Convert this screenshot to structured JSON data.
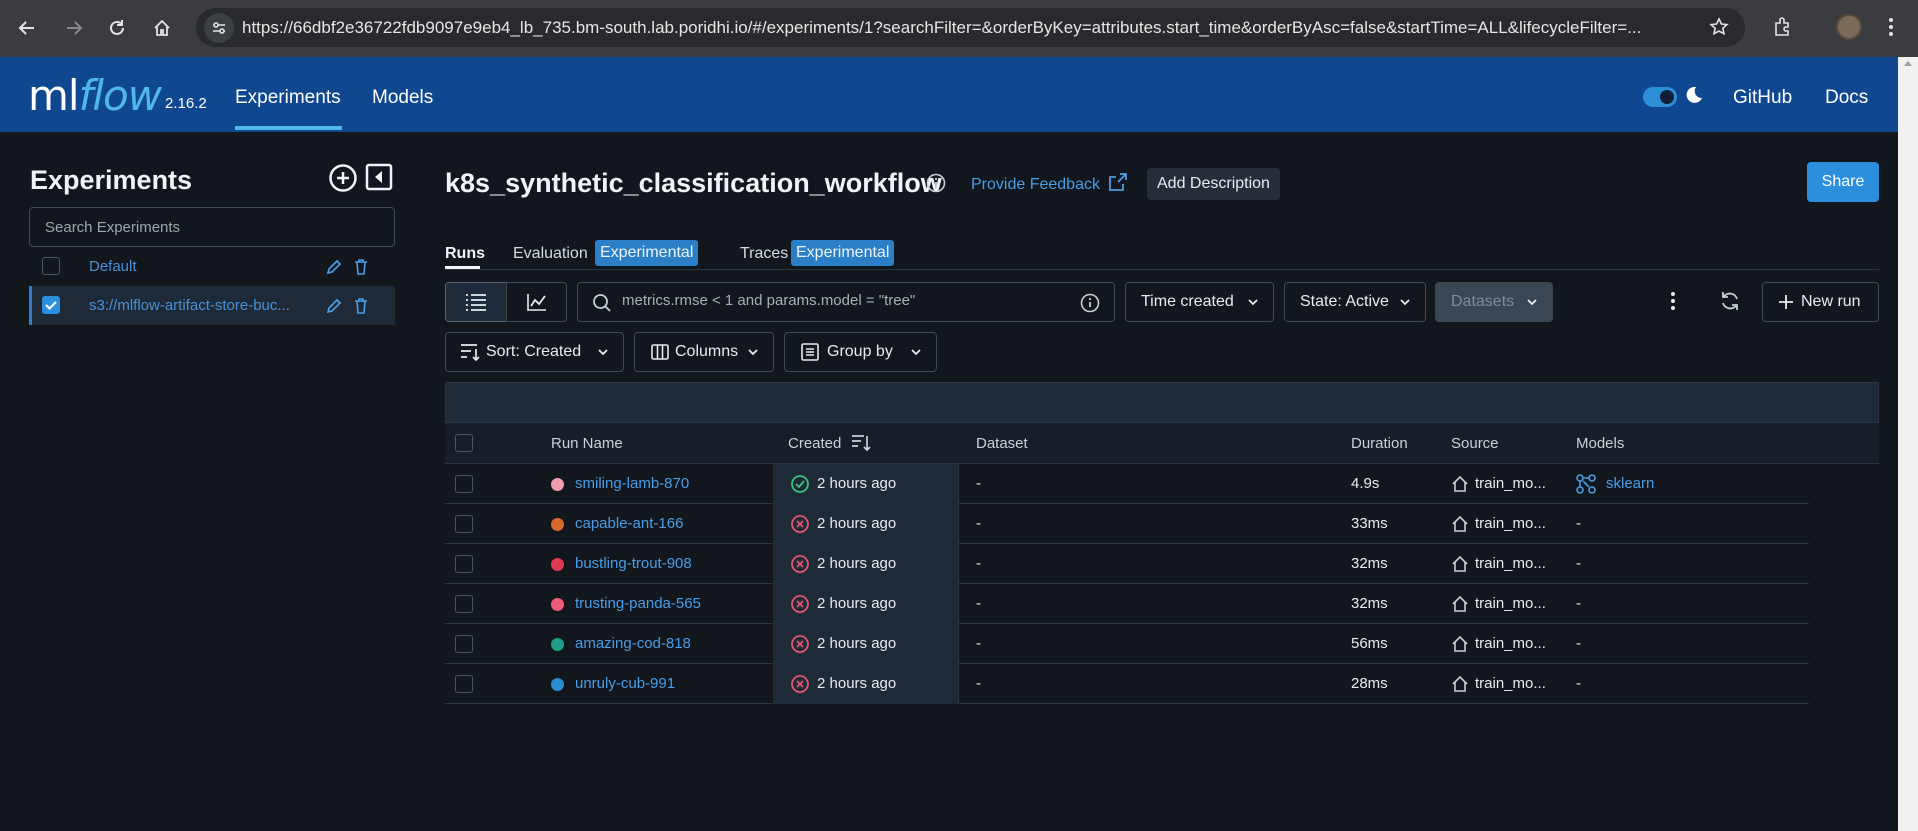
{
  "browser": {
    "url": "https://66dbf2e36722fdb9097e9eb4_lb_735.bm-south.lab.poridhi.io/#/experiments/1?searchFilter=&orderByKey=attributes.start_time&orderByAsc=false&startTime=ALL&lifecycleFilter=..."
  },
  "header": {
    "logo_ml": "ml",
    "logo_flow": "flow",
    "version": "2.16.2",
    "nav": {
      "experiments": "Experiments",
      "models": "Models",
      "github": "GitHub",
      "docs": "Docs"
    }
  },
  "sidebar": {
    "title": "Experiments",
    "search_placeholder": "Search Experiments",
    "items": [
      {
        "name": "Default",
        "checked": false
      },
      {
        "name": "s3://mlflow-artifact-store-buc...",
        "checked": true
      }
    ]
  },
  "main": {
    "title": "k8s_synthetic_classification_workflow",
    "feedback": "Provide Feedback",
    "add_description": "Add Description",
    "share": "Share",
    "tabs": {
      "runs": "Runs",
      "evaluation": "Evaluation",
      "traces": "Traces",
      "badge": "Experimental"
    },
    "search_placeholder": "metrics.rmse < 1 and params.model = \"tree\"",
    "filters": {
      "time_created": "Time created",
      "state": "State: Active",
      "datasets": "Datasets"
    },
    "new_run": "New run",
    "sort": "Sort: Created",
    "columns": "Columns",
    "group_by": "Group by"
  },
  "table": {
    "headers": {
      "run_name": "Run Name",
      "created": "Created",
      "dataset": "Dataset",
      "duration": "Duration",
      "source": "Source",
      "models": "Models"
    },
    "rows": [
      {
        "name": "smiling-lamb-870",
        "color": "#f29db1",
        "status": "success",
        "created": "2 hours ago",
        "dataset": "-",
        "duration": "4.9s",
        "source": "train_mo...",
        "model": "sklearn"
      },
      {
        "name": "capable-ant-166",
        "color": "#d9692b",
        "status": "failed",
        "created": "2 hours ago",
        "dataset": "-",
        "duration": "33ms",
        "source": "train_mo...",
        "model": "-"
      },
      {
        "name": "bustling-trout-908",
        "color": "#e03a52",
        "status": "failed",
        "created": "2 hours ago",
        "dataset": "-",
        "duration": "32ms",
        "source": "train_mo...",
        "model": "-"
      },
      {
        "name": "trusting-panda-565",
        "color": "#ee5a78",
        "status": "failed",
        "created": "2 hours ago",
        "dataset": "-",
        "duration": "32ms",
        "source": "train_mo...",
        "model": "-"
      },
      {
        "name": "amazing-cod-818",
        "color": "#1f9e8a",
        "status": "failed",
        "created": "2 hours ago",
        "dataset": "-",
        "duration": "56ms",
        "source": "train_mo...",
        "model": "-"
      },
      {
        "name": "unruly-cub-991",
        "color": "#2a8fcf",
        "status": "failed",
        "created": "2 hours ago",
        "dataset": "-",
        "duration": "28ms",
        "source": "train_mo...",
        "model": "-"
      }
    ]
  }
}
